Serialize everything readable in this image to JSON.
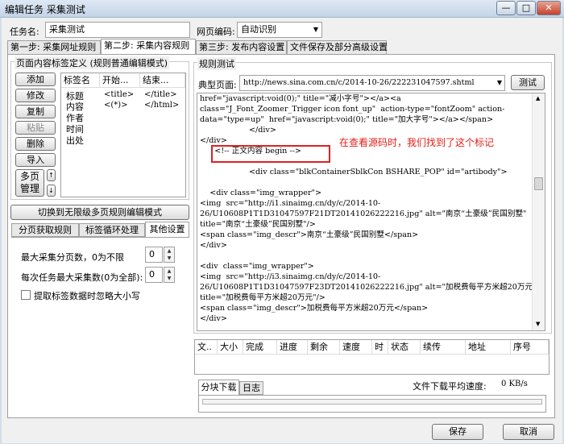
{
  "window": {
    "title": "编辑任务 采集测试",
    "min": "—",
    "max": "□",
    "close": "✕"
  },
  "top": {
    "task_name_label": "任务名:",
    "task_name_value": "采集测试",
    "encoding_label": "网页编码:",
    "encoding_value": "自动识别"
  },
  "tabs": [
    "第一步: 采集网址规则",
    "第二步: 采集内容规则",
    "第三步: 发布内容设置",
    "文件保存及部分高级设置"
  ],
  "left": {
    "group_title": "页面内容标签定义  (规则普通编辑模式)",
    "buttons": [
      "添加",
      "修改",
      "复制",
      "粘贴",
      "删除",
      "导入"
    ],
    "multi_page_button": "多页\n管理",
    "table_headers": [
      "标签名",
      "开始...",
      "结束..."
    ],
    "rows": [
      {
        "name": "标题",
        "start": "<title>",
        "end": "</title>"
      },
      {
        "name": "内容",
        "start": "<(*)>",
        "end": "</html>"
      },
      {
        "name": "作者",
        "start": "",
        "end": ""
      },
      {
        "name": "时间",
        "start": "",
        "end": ""
      },
      {
        "name": "出处",
        "start": "",
        "end": ""
      }
    ],
    "switch_button": "切换到无限级多页规则编辑模式",
    "sub_tabs": [
      "分页获取规则",
      "标签循环处理",
      "其他设置"
    ],
    "max_pages_label": "最大采集分页数，0为不限",
    "max_pages_value": "0",
    "max_items_label": "每次任务最大采集数(0为全部):",
    "max_items_value": "0",
    "ignore_case_label": "提取标签数据时忽略大小写"
  },
  "right": {
    "group_title": "规则测试",
    "url_label": "典型页面:",
    "url_value": "http://news.sina.com.cn/c/2014-10-26/222231047597.shtml",
    "test_button": "测试",
    "annotation": "在查看源码时，我们找到了这个标记",
    "source_lines": [
      "href=\"javascript:void(0);\" title=\"减小字号\"></a><a",
      "class=\"J_Font_Zoomer_Trigger icon font_up\"  action-type=\"fontZoom\" action-",
      "data=\"type=up\"  href=\"javascript:void(0);\" title=\"加大字号\"></a></span>",
      "                    </div>",
      "</div>",
      "      <!-- 正文内容 begin -->",
      "",
      "                    <div class=\"blkContainerSblkCon BSHARE_POP\" id=\"artibody\">",
      "",
      "    <div class=\"img_wrapper\">",
      "<img  src=\"http://i1.sinaimg.cn/dy/c/2014-10-",
      "26/U10608P1T1D31047597F21DT20141026222216.jpg\" alt=\"南京“土豪级”民国别墅\"",
      "title=\"南京“土豪级”民国别墅\"/>",
      "<span class=\"img_descr\">南京“土豪级”民国别墅</span>",
      "</div>",
      "",
      "<div  class=\"img_wrapper\">",
      "<img  src=\"http://i3.sinaimg.cn/dy/c/2014-10-",
      "26/U10608P1T1D31047597F23DT20141026222216.jpg\" alt=\"加税费每平方米超20万元\"",
      "title=\"加税费每平方米超20万元\"/>",
      "<span class=\"img_descr\">加税费每平方米超20万元</span>",
      "</div>"
    ],
    "download_headers": [
      "文..",
      "大小",
      "完成",
      "进度",
      "剩余",
      "速度",
      "时",
      "状态",
      "续传",
      "地址",
      "序号"
    ],
    "bottom_tabs": [
      "分块下载",
      "日志"
    ],
    "speed_label": "文件下载平均速度:",
    "speed_value": "0 KB/s"
  },
  "footer": {
    "save": "保存",
    "cancel": "取消"
  },
  "colors": {
    "annotation": "#e0201a",
    "highlight_box": "#e02020"
  }
}
